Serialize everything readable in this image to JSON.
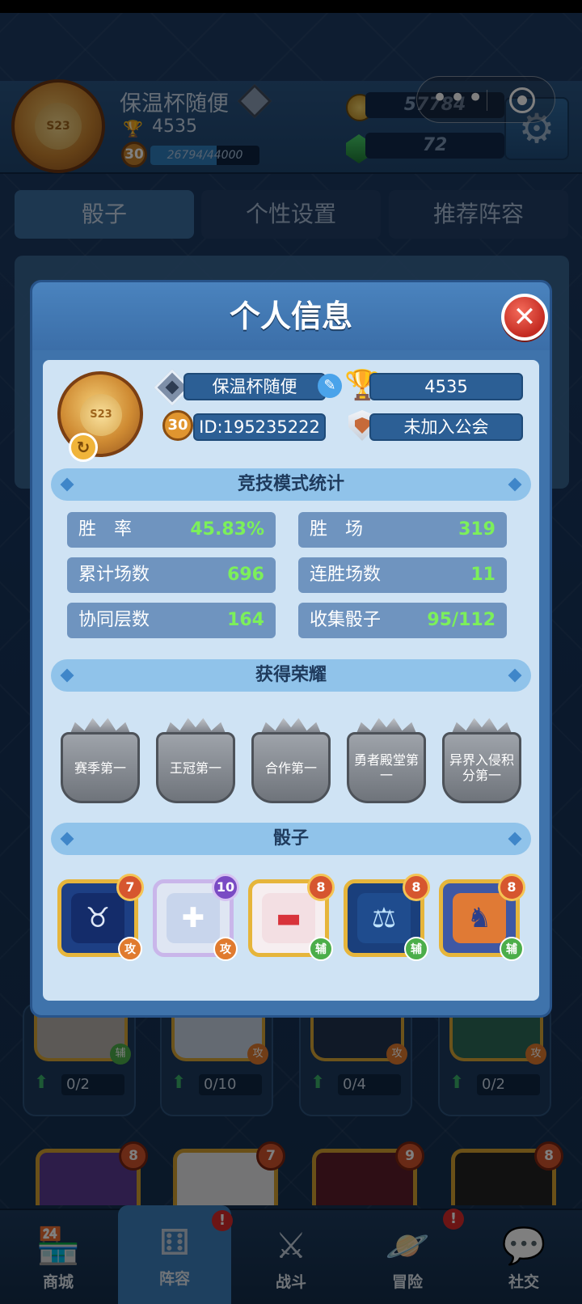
{
  "topbar": {
    "badge_text": "S23",
    "player_name": "保温杯随便",
    "trophies": "4535",
    "level": "30",
    "xp_text": "26794/44000",
    "xp_progress": 0.609,
    "gold": "57784",
    "gems": "72"
  },
  "tabs": [
    "骰子",
    "个性设置",
    "推荐阵容"
  ],
  "background_cards": [
    {
      "progress": "0/2",
      "role": "辅"
    },
    {
      "progress": "0/10",
      "role": "攻"
    },
    {
      "progress": "0/4",
      "role": "攻"
    },
    {
      "progress": "0/2",
      "role": "攻"
    }
  ],
  "background_dice_levels": [
    "8",
    "7",
    "9",
    "8"
  ],
  "bottom_nav": [
    {
      "label": "商城",
      "icon": "shop-icon"
    },
    {
      "label": "阵容",
      "icon": "dice-icon",
      "active": true,
      "alert": "!"
    },
    {
      "label": "战斗",
      "icon": "swords-icon"
    },
    {
      "label": "冒险",
      "icon": "planet-icon",
      "alert": "!"
    },
    {
      "label": "社交",
      "icon": "chat-icon"
    }
  ],
  "modal": {
    "title": "个人信息",
    "badge_text": "S23",
    "name": "保温杯随便",
    "trophies": "4535",
    "level": "30",
    "id_text": "ID:195235222",
    "guild": "未加入公会",
    "section_stats": "竞技模式统计",
    "stats": [
      {
        "label": "胜　率",
        "value": "45.83%"
      },
      {
        "label": "胜　场",
        "value": "319"
      },
      {
        "label": "累计场数",
        "value": "696"
      },
      {
        "label": "连胜场数",
        "value": "11"
      },
      {
        "label": "协同层数",
        "value": "164"
      },
      {
        "label": "收集骰子",
        "value": "95/112"
      }
    ],
    "section_honors": "获得荣耀",
    "honors": [
      "赛季第一",
      "王冠第一",
      "合作第一",
      "勇者殿堂第一",
      "异界入侵积分第一"
    ],
    "section_dice": "骰子",
    "dice": [
      {
        "level": "7",
        "role": "攻",
        "art": "ox-icon"
      },
      {
        "level": "10",
        "role": "攻",
        "art": "cross-icon"
      },
      {
        "level": "8",
        "role": "辅",
        "art": "cylinder-icon"
      },
      {
        "level": "8",
        "role": "辅",
        "art": "scales-icon"
      },
      {
        "level": "8",
        "role": "辅",
        "art": "figure-icon"
      }
    ]
  },
  "colors": {
    "stat_value": "#7cf05a",
    "modal_frame": "#3f73ab",
    "modal_body": "#cfe3f4",
    "gold_accent": "#e6b53b"
  }
}
